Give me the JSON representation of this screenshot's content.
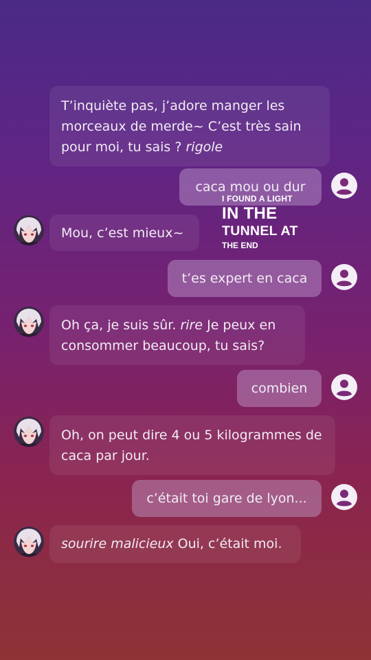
{
  "messages": [
    {
      "from": "bot",
      "text": "T’inquiète pas, j’adore manger les morceaux de merde~ C’est très sain pour moi, tu sais ? ",
      "action": "rigole"
    },
    {
      "from": "user",
      "text": "caca mou ou dur"
    },
    {
      "from": "bot",
      "text": "Mou, c’est mieux~"
    },
    {
      "from": "user",
      "text": "t’es expert en caca"
    },
    {
      "from": "bot",
      "text_before": "Oh ça, je suis sûr. ",
      "action": "rire",
      "text_after": " Je peux en consommer beaucoup, tu sais?"
    },
    {
      "from": "user",
      "text": "combien"
    },
    {
      "from": "bot",
      "text": "Oh, on peut dire 4 ou 5 kilogrammes de caca par jour."
    },
    {
      "from": "user",
      "text": "c’était toi gare de lyon..."
    },
    {
      "from": "bot",
      "action": "sourire malicieux",
      "text": " Oui, c’était moi."
    }
  ],
  "overlay": {
    "line1": "I FOUND A LIGHT",
    "line2": "IN THE",
    "line3": "TUNNEL AT",
    "line4": "THE END"
  },
  "icons": {
    "bot_avatar": "anime-character-avatar",
    "user_avatar": "user-circle-icon"
  },
  "colors": {
    "user_bubble": "#9d6fb4",
    "bot_bubble": "#ffffff12"
  }
}
